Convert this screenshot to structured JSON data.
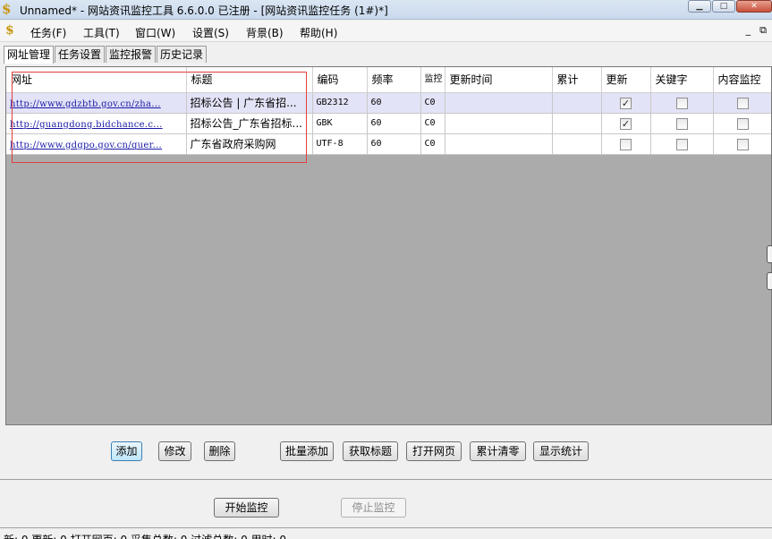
{
  "window": {
    "title": "Unnamed* - 网站资讯监控工具 6.6.0.0  已注册 - [网站资讯监控任务  (1#)*]",
    "app_icon": "$",
    "min": "▁",
    "max": "□",
    "close": "✕"
  },
  "menu": {
    "icon": "$",
    "items": [
      "任务(F)",
      "工具(T)",
      "窗口(W)",
      "设置(S)",
      "背景(B)",
      "帮助(H)"
    ],
    "mdi_min": "_",
    "mdi_restore": "⧉"
  },
  "tabs": [
    "网址管理",
    "任务设置",
    "监控报警",
    "历史记录"
  ],
  "grid": {
    "headers": {
      "url": "网址",
      "title": "标题",
      "encoding": "编码",
      "frequency": "频率",
      "monitor": "监控",
      "update_time": "更新时间",
      "total": "累计",
      "update": "更新",
      "keyword": "关键字",
      "content_monitor": "内容监控"
    },
    "rows": [
      {
        "url": "http://www.gdzbtb.gov.cn/zha...",
        "title": "招标公告 | 广东省招...",
        "encoding": "GB2312",
        "frequency": "60",
        "monitor": "C0",
        "update_time": "",
        "total": "",
        "update": true,
        "keyword": false,
        "content_monitor": false
      },
      {
        "url": "http://guangdong.bidchance.c...",
        "title": "招标公告_广东省招标...",
        "encoding": "GBK",
        "frequency": "60",
        "monitor": "C0",
        "update_time": "",
        "total": "",
        "update": true,
        "keyword": false,
        "content_monitor": false
      },
      {
        "url": "http://www.gdgpo.gov.cn/quer...",
        "title": "广东省政府采购网",
        "encoding": "UTF-8",
        "frequency": "60",
        "monitor": "C0",
        "update_time": "",
        "total": "",
        "update": false,
        "keyword": false,
        "content_monitor": false
      }
    ]
  },
  "buttons": {
    "add": "添加",
    "edit": "修改",
    "delete": "删除",
    "batch_add": "批量添加",
    "fetch_title": "获取标题",
    "open_page": "打开网页",
    "clear_total": "累计清零",
    "show_stats": "显示统计",
    "start": "开始监控",
    "stop": "停止监控"
  },
  "status": "新: 0  更新: 0  打开网页: 0  采集总数: 0  过滤总数: 0  用时: 0"
}
